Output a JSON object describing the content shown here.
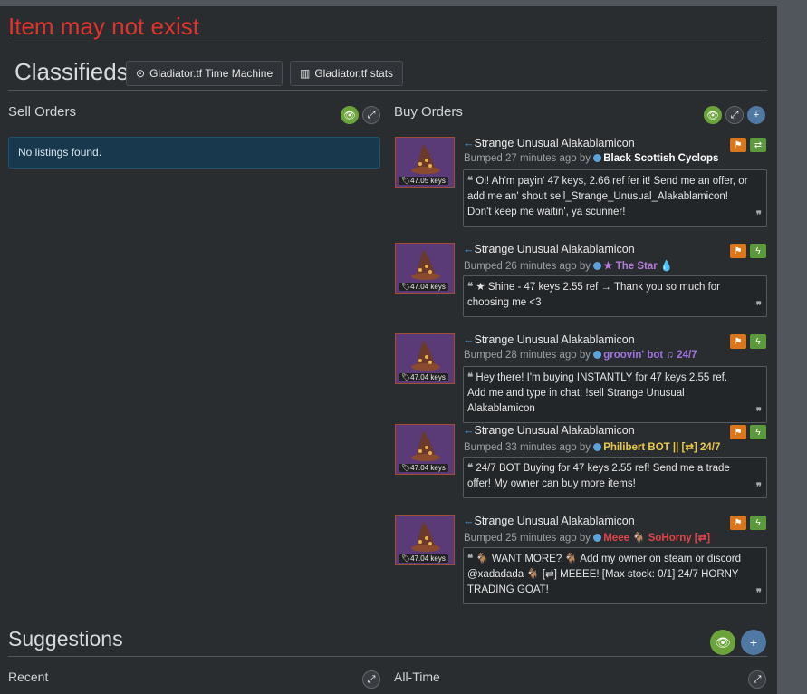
{
  "warning": "Item may not exist",
  "classifieds": {
    "title": "Classifieds",
    "time_machine_label": "Gladiator.tf Time Machine",
    "stats_label": "Gladiator.tf stats"
  },
  "sell": {
    "heading": "Sell Orders",
    "empty_text": "No listings found."
  },
  "buy": {
    "heading": "Buy Orders",
    "listings": [
      {
        "item": "Strange Unusual Alakablamicon",
        "price": "47.05 keys",
        "bumped": "Bumped 27 minutes ago by",
        "user": "Black Scottish Cyclops",
        "user_color": "#ffffff",
        "action_icon": "trade-icon",
        "message": "Oi! Ah'm payin' 47 keys, 2.66 ref fer it! Send me an offer, or add me an' shout sell_Strange_Unusual_Alakablamicon! Don't keep me waitin', ya scunner!"
      },
      {
        "item": "Strange Unusual Alakablamicon",
        "price": "47.04 keys",
        "bumped": "Bumped 26 minutes ago by",
        "user": "★ The Star 💧",
        "user_color": "#b57ad9",
        "action_icon": "lightning-icon",
        "message": "★ Shine - 47 keys 2.55 ref → Thank you so much for choosing me <3"
      },
      {
        "item": "Strange Unusual Alakablamicon",
        "price": "47.04 keys",
        "bumped": "Bumped 28 minutes ago by",
        "user": "groovin' bot ♫ 24/7",
        "user_color": "#a073e0",
        "action_icon": "lightning-icon",
        "message": "Hey there! I'm buying INSTANTLY for 47 keys 2.55 ref. Add me and type in chat: !sell Strange Unusual Alakablamicon"
      },
      {
        "item": "Strange Unusual Alakablamicon",
        "price": "47.04 keys",
        "bumped": "Bumped 33 minutes ago by",
        "user": "Philibert BOT || [⇄] 24/7",
        "user_color": "#e8c84a",
        "action_icon": "lightning-icon",
        "message": "24/7 BOT Buying for 47 keys 2.55 ref! Send me a trade offer! My owner can buy more items!"
      },
      {
        "item": "Strange Unusual Alakablamicon",
        "price": "47.04 keys",
        "bumped": "Bumped 25 minutes ago by",
        "user": "Meee 🐐 SoHorny [⇄]",
        "user_color": "#e0444a",
        "action_icon": "lightning-icon",
        "message": "🐐 WANT MORE? 🐐 Add my owner on steam or discord @xadadada 🐐 [⇄] MEEEE! [Max stock: 0/1] 24/7 HORNY TRADING GOAT!"
      }
    ]
  },
  "suggestions": {
    "title": "Suggestions",
    "recent": "Recent",
    "all_time": "All-Time"
  },
  "colors": {
    "warning": "#e0332b",
    "accent_green": "#6ca43c",
    "flag_orange": "#d9761e",
    "info_bg": "#17384d"
  }
}
